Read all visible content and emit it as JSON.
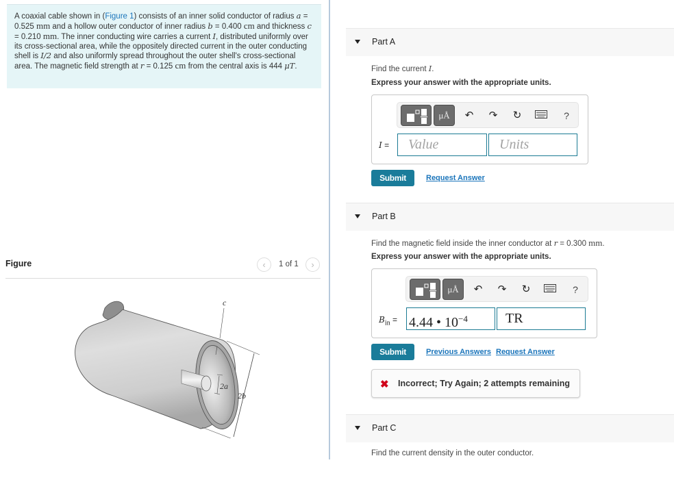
{
  "problem": {
    "intro": "A coaxial cable shown in (",
    "figure_link": "Figure 1",
    "t1": ") consists of an inner solid conductor of radius ",
    "a_sym": "a",
    "a_val": " = 0.525 ",
    "a_unit": "mm",
    "t2": " and a hollow outer conductor of inner radius ",
    "b_sym": "b",
    "b_val": " = 0.400 ",
    "b_unit": "cm",
    "t3": " and thickness ",
    "c_sym": "c",
    "c_val": " = 0.210 ",
    "c_unit": "mm",
    "t4": ". The inner conducting wire carries a current ",
    "I_sym": "I",
    "t5": ", distributed uniformly over its cross-sectional area, while the oppositely directed current in the outer conducting shell is ",
    "I2_sym": "I/2",
    "t6": " and also uniformly spread throughout the outer shell's cross-sectional area. The magnetic field strength at ",
    "r_sym": "r",
    "r_val": " = 0.125 ",
    "r_unit": "cm",
    "t7": " from the central axis is 444 ",
    "field_unit": "μT",
    "t8": "."
  },
  "figure": {
    "title": "Figure",
    "counter": "1 of 1",
    "prev_icon": "chevron-left-icon",
    "next_icon": "chevron-right-icon",
    "labels": {
      "c": "c",
      "two_a": "2a",
      "two_b": "2b"
    }
  },
  "toolbar": {
    "templates_icon": "templates-icon",
    "units_label": "μÅ",
    "undo_icon": "↶",
    "redo_icon": "↷",
    "reset_icon": "↻",
    "keyboard_icon": "keyboard-icon",
    "help_label": "?"
  },
  "parts": [
    {
      "title": "Part A",
      "prompt_pre": "Find the current ",
      "prompt_sym": "I",
      "prompt_post": ".",
      "express": "Express your answer with the appropriate units.",
      "field_label_sym": "I",
      "field_label_eq": " =",
      "value_placeholder": "Value",
      "units_placeholder": "Units",
      "submit": "Submit",
      "request_answer": "Request Answer"
    },
    {
      "title": "Part B",
      "prompt_pre": "Find the magnetic field inside the inner conductor at ",
      "prompt_sym": "r",
      "prompt_val": " = 0.300 ",
      "prompt_unit": "mm",
      "prompt_post": ".",
      "express": "Express your answer with the appropriate units.",
      "field_label_sym": "B",
      "field_label_sub": "in",
      "field_label_eq": " =",
      "value_mantissa": "4.44 • 10",
      "value_exponent": "−4",
      "units_value": "TR",
      "submit": "Submit",
      "previous_answers": "Previous Answers",
      "request_answer": "Request Answer",
      "feedback": "Incorrect; Try Again; 2 attempts remaining",
      "feedback_icon": "✖"
    },
    {
      "title": "Part C",
      "prompt": "Find the current density in the outer conductor."
    }
  ],
  "colors": {
    "accent": "#1a7c9a",
    "link": "#1b75bb",
    "problem_bg": "#e5f5f7",
    "error": "#d0021b"
  }
}
